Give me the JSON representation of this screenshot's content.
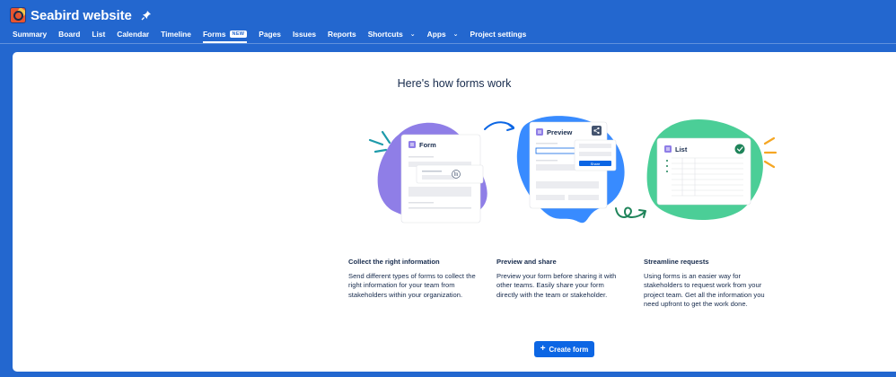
{
  "project": {
    "title": "Seabird website",
    "avatar_icon": "seabird-avatar-icon",
    "pin_icon": "pin-icon"
  },
  "nav": {
    "items": [
      {
        "label": "Summary"
      },
      {
        "label": "Board"
      },
      {
        "label": "List"
      },
      {
        "label": "Calendar"
      },
      {
        "label": "Timeline"
      },
      {
        "label": "Forms",
        "badge": "NEW",
        "active": true
      },
      {
        "label": "Pages"
      },
      {
        "label": "Issues"
      },
      {
        "label": "Reports"
      },
      {
        "label": "Shortcuts",
        "dropdown": true
      },
      {
        "label": "Apps",
        "dropdown": true
      },
      {
        "label": "Project settings"
      }
    ]
  },
  "main": {
    "title": "Here's how forms work",
    "illustration": {
      "form_card_title": "Form",
      "preview_card_title": "Preview",
      "share_button_label": "Share",
      "list_card_title": "List"
    },
    "columns": [
      {
        "title": "Collect the right information",
        "text": "Send different types of forms to collect the right information for your team from stakeholders within your organization."
      },
      {
        "title": "Preview and share",
        "text": "Preview your form before sharing it with other teams. Easily share your form directly with the team or stakeholder."
      },
      {
        "title": "Streamline requests",
        "text": "Using forms is an easier way for stakeholders to request work from your project team. Get all the information you need upfront to get the work done."
      }
    ],
    "create_button_label": "Create form"
  },
  "colors": {
    "header_bg": "#2367cf",
    "primary_button": "#0c66e4",
    "purple_blob": "#8f7ee7",
    "blue_blob": "#388bff",
    "green_blob": "#4bce97"
  }
}
